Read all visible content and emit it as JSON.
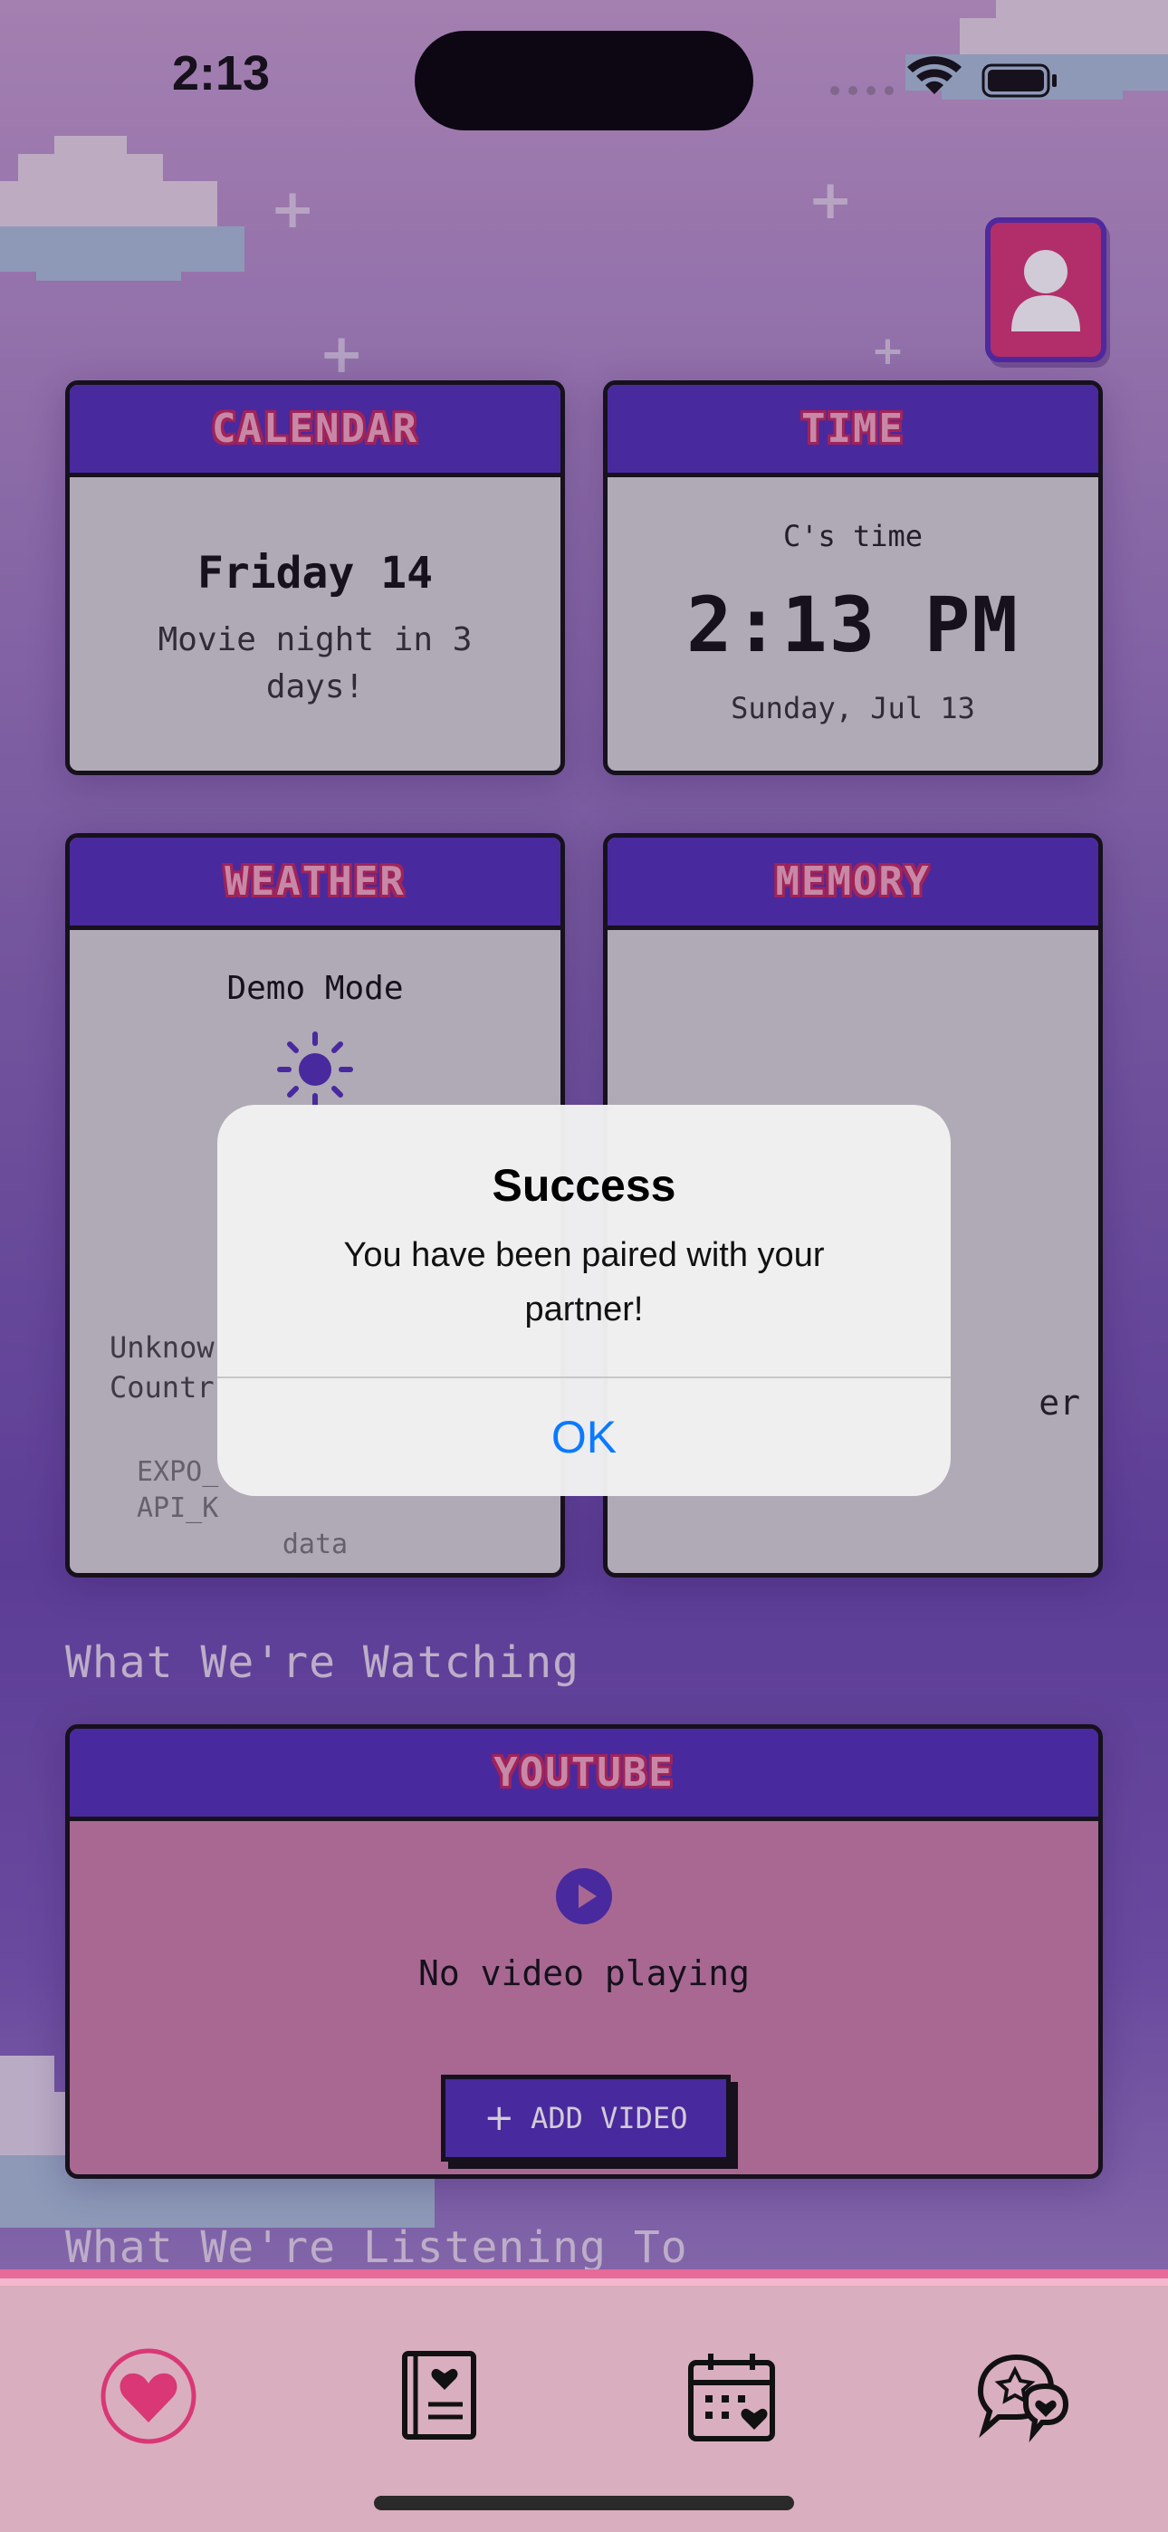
{
  "status_bar": {
    "time": "2:13"
  },
  "profile": {
    "icon": "user-icon"
  },
  "calendar": {
    "title": "CALENDAR",
    "date": "Friday 14",
    "note": "Movie night in 3 days!"
  },
  "time_card": {
    "title": "TIME",
    "label": "C's time",
    "time": "2:13 PM",
    "date": "Sunday, Jul 13"
  },
  "weather": {
    "title": "WEATHER",
    "mode": "Demo Mode",
    "icon": "sun-icon",
    "location_line1": "Unknow",
    "location_line2": "Countr",
    "error_line1": "EXPO_",
    "error_line2": "API_K",
    "error_line3": "data"
  },
  "memory": {
    "title": "MEMORY",
    "partner_fragment": "er"
  },
  "sections": {
    "watching": "What We're Watching",
    "listening": "What We're Listening To"
  },
  "youtube": {
    "title": "YOUTUBE",
    "status": "No video playing",
    "add_label": "ADD VIDEO"
  },
  "alert": {
    "title": "Success",
    "message": "You have been paired with your partner!",
    "ok_label": "OK"
  },
  "nav": {
    "items": [
      "heart-icon",
      "journal-icon",
      "calendar-icon",
      "chat-icon"
    ]
  },
  "colors": {
    "card_header": "#5230b8",
    "title_pink": "#f4a9c3",
    "profile_bg": "#d93775",
    "youtube_bg": "#cc80a8",
    "ios_blue": "#0a7aff"
  }
}
